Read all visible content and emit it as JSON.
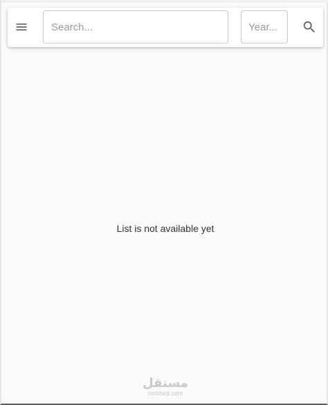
{
  "toolbar": {
    "menu_icon": "menu-icon",
    "search_placeholder": "Search...",
    "search_value": "",
    "year_placeholder": "Year...",
    "year_value": "",
    "search_icon": "search-icon"
  },
  "content": {
    "empty_message": "List is not available yet"
  },
  "watermark": {
    "arabic": "مستقل",
    "latin": "mostaql.com"
  },
  "colors": {
    "background": "#fafafa",
    "toolbar": "#ffffff",
    "icon": "#616161",
    "border": "#c7c7c7"
  }
}
